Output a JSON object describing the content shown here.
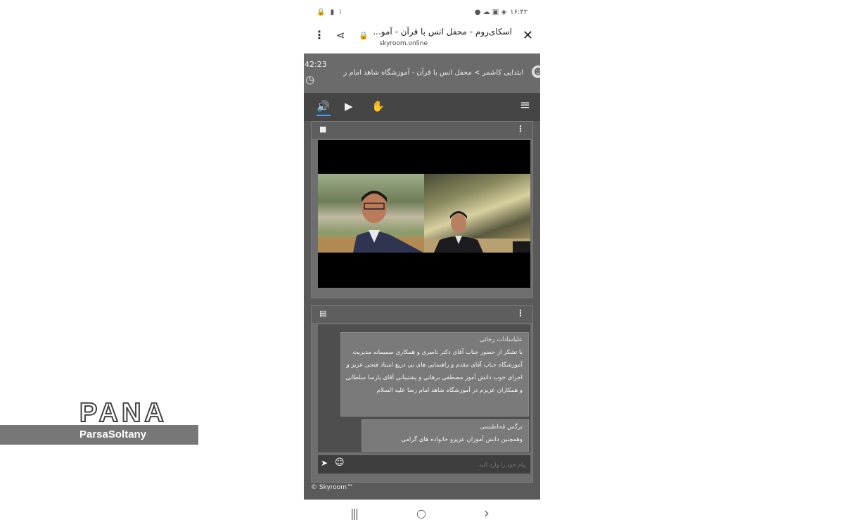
{
  "status_bar": {
    "left_icons": "🔒 ▮ ⁞",
    "clock": "۱۶:۴۳",
    "right_icons": "● ☁ ▣ ◈"
  },
  "browser": {
    "tab_title": "اسکای‌روم - محفل انس با قرآن - آمو...",
    "url": "skyroom.online",
    "close_icon": "✕",
    "lock_icon": "🔒",
    "share_icon": "⋖",
    "menu_icon": "⋮"
  },
  "room": {
    "elapsed": "42:23",
    "clock_icon": "◷",
    "breadcrumb": "ابتدایی کاشمر > محفل انس با قرآن - آموزشگاه شاهد امام ر",
    "avatar_icon": "☻"
  },
  "toolbar": {
    "speaker_icon": "🔊",
    "play_icon": "▶",
    "hand_icon": "✋",
    "menu_icon": "≡"
  },
  "video_panel": {
    "camera_icon": "■",
    "more_icon": "⋮"
  },
  "chat_panel": {
    "chat_icon": "▤",
    "more_icon": "⋮",
    "messages": [
      {
        "name": "علیاسادات رجائی",
        "body": "با تشکر از حضور جناب آقای دکتر ناصری و همکاری صمیمانه مدیریت آموزشگاه جناب آقای مقدم و راهنمایی های بی دریغ استاد فتحی عزیز و اجرای خوب دانش آموز مصطفی برهانی و پشتیبانی آقای پارسا سلطانی و همکاران عزیزم در آموزشگاه شاهد امام رضا علیه السلام"
      },
      {
        "name": "نرگس قحاطبسی",
        "body": "وهمچنین دانش آموزان عزیزو خانواده های گرامی"
      }
    ],
    "input_placeholder": "پیام خود را وارد کنید.",
    "send_icon": "➤",
    "emoji_icon": "☺"
  },
  "footer": {
    "copyright": "© Skyroom™"
  },
  "nav": {
    "recents_icon": "|||",
    "home_icon": "○",
    "back_icon": "›"
  },
  "watermark": {
    "title": "PANA",
    "subtitle": "ParsaSoltany"
  }
}
